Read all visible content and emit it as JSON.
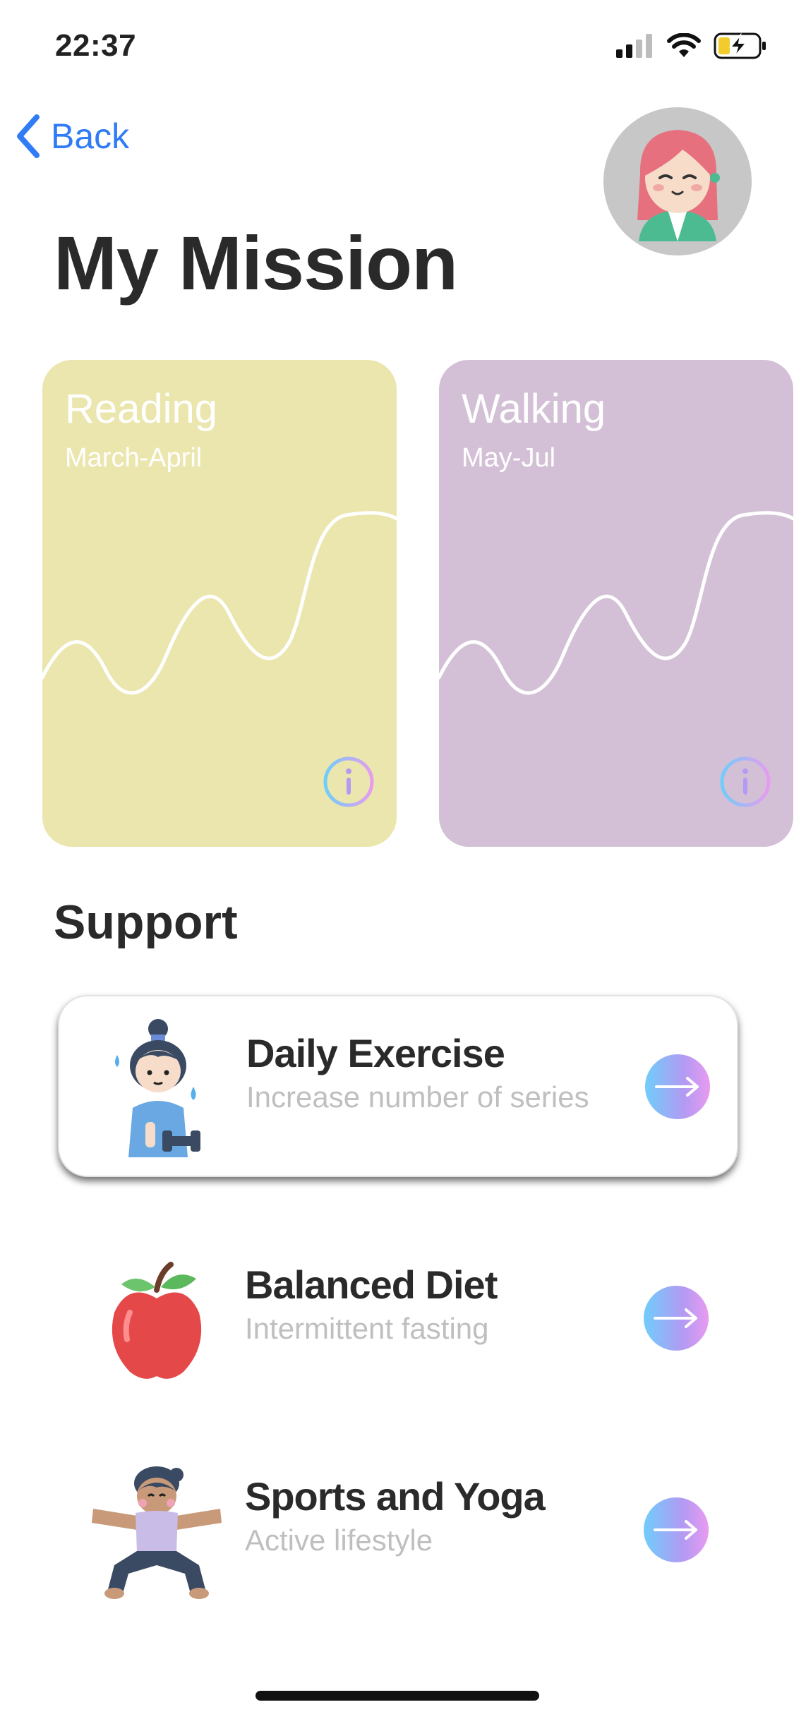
{
  "status_bar": {
    "time": "22:37"
  },
  "header": {
    "back_label": "Back",
    "title": "My Mission"
  },
  "missions": [
    {
      "title": "Reading",
      "period": "March-April",
      "color": "#ebe6ad"
    },
    {
      "title": "Walking",
      "period": "May-Jul",
      "color": "#d3c0d6"
    }
  ],
  "support": {
    "title": "Support",
    "items": [
      {
        "title": "Daily Exercise",
        "subtitle": "Increase number of series",
        "icon": "exercise-girl-icon"
      },
      {
        "title": "Balanced Diet",
        "subtitle": "Intermittent fasting",
        "icon": "apple-icon"
      },
      {
        "title": "Sports and Yoga",
        "subtitle": "Active lifestyle",
        "icon": "yoga-girl-icon"
      }
    ]
  },
  "colors": {
    "accent": "#2f7cf6",
    "card_reading": "#ebe6ad",
    "card_walking": "#d3c0d6"
  }
}
